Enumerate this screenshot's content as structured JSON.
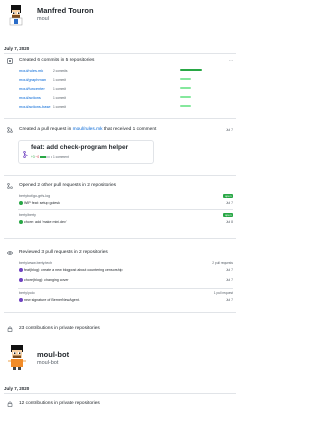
{
  "users": [
    {
      "name": "Manfred Touron",
      "handle": "moul"
    },
    {
      "name": "moul-bot",
      "handle": "moul-bot"
    }
  ],
  "date_headers": [
    "July 7, 2020",
    "July 7, 2020"
  ],
  "commits_section": {
    "prefix": "Created 6 commits in 5 repositories",
    "repos": [
      {
        "name": "moul/rules.mk",
        "count": "2 commits",
        "fill": 1.0
      },
      {
        "name": "moul/graphman",
        "count": "1 commit",
        "fill": 0.5
      },
      {
        "name": "moul/funcenter",
        "count": "1 commit",
        "fill": 0.5
      },
      {
        "name": "moul/actions",
        "count": "1 commit",
        "fill": 0.5
      },
      {
        "name": "moul/actions-base",
        "count": "1 commit",
        "fill": 0.5
      }
    ]
  },
  "pr_section": {
    "text_before": "Created a pull request in",
    "repo": "moul/rules.mk",
    "text_after": "that received 1 comment",
    "date": "Jul 7",
    "pr_title": "feat: add check-program helper",
    "additions": "+3",
    "deletions": "−0",
    "comments": "1 comment"
  },
  "other_prs_section": {
    "title": "Opened 2 other pull requests in 2 repositories",
    "items": [
      {
        "repo": "bertybot/go-grfs-log",
        "title": "WIP feat: setup golesk",
        "status": "open",
        "date": "Jul 7"
      },
      {
        "repo": "berty/berty",
        "title": "chore: add 'make mini.dev'",
        "status": "open",
        "date": "Jul 8"
      }
    ]
  },
  "reviews_section": {
    "title": "Reviewed 3 pull requests in 2 repositories",
    "groups": [
      {
        "repo": "berty/www.berty.tech",
        "count": "2 pull requests",
        "items": [
          {
            "title": "feat(blog): create a new blogpost about countering censorship",
            "date": "Jul 7"
          },
          {
            "title": "chore(blog): changing cover",
            "date": "Jul 7"
          }
        ]
      },
      {
        "repo": "berty/yolo",
        "count": "1 pull request",
        "items": [
          {
            "title": "new signature of BernerNewAgent.",
            "date": "Jul 7"
          }
        ]
      }
    ]
  },
  "private_contrib": [
    "23 contributions in private repositories",
    "12 contributions in private repositories"
  ],
  "colors": {
    "green": "#28a745",
    "blue": "#0366d6",
    "purple": "#6f42c1"
  }
}
